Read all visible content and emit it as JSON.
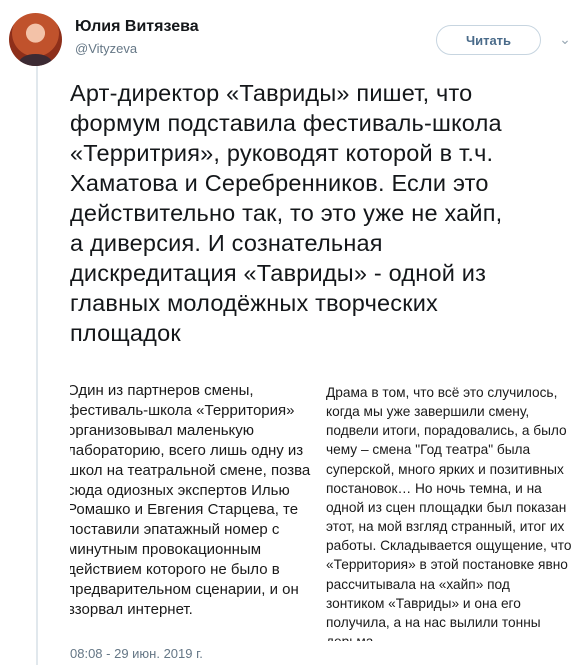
{
  "author": {
    "name": "Юлия Витязева",
    "handle": "@Vityzeva"
  },
  "follow_button": {
    "label": "Читать"
  },
  "menu": {
    "icon": "chevron-down-icon"
  },
  "tweet": {
    "text": "Арт-директор «Тавриды» пишет, что\nформум подставила фестиваль-школа\n«Территрия», руководят которой в т.ч.\nХаматова и Серебренников. Если это\nдействительно так, то это уже не хайп,\nа диверсия. И сознательная\nдискредитация «Тавриды» - одной из\nглавных молодёжных творческих\nплощадок",
    "timestamp": "08:08 - 29 июн. 2019 г."
  },
  "clippings": {
    "left": "Один из партнеров смены,\nфестиваль-школа «Территория»\nорганизовывал маленькую\nлабораторию, всего лишь одну из\nшкол на театральной смене, позва\nсюда одиозных экспертов Илью\nРомашко и Евгения Старцева, те\nпоставили эпатажный номер с\nминутным провокационным\nдействием которого не было в\nпредварительном сценарии, и он\nвзорвал интернет.",
    "right": "Драма в том, что всё это случилось,\nкогда мы уже завершили смену,\nподвели итоги, порадовались, а было\nчему – смена \"Год театра\" была\nсуперской, много ярких и позитивных\nпостановок… Но ночь темна, и на\nодной из сцен площадки был показан\nэтот, на мой взгляд странный, итог их\nработы. Складывается ощущение, что\n«Территория» в этой постановке явно\nрассчитывала на «хайп» под\nзонтиком «Тавриды» и она его\nполучила, а на нас вылили тонны\nдерьма."
  }
}
